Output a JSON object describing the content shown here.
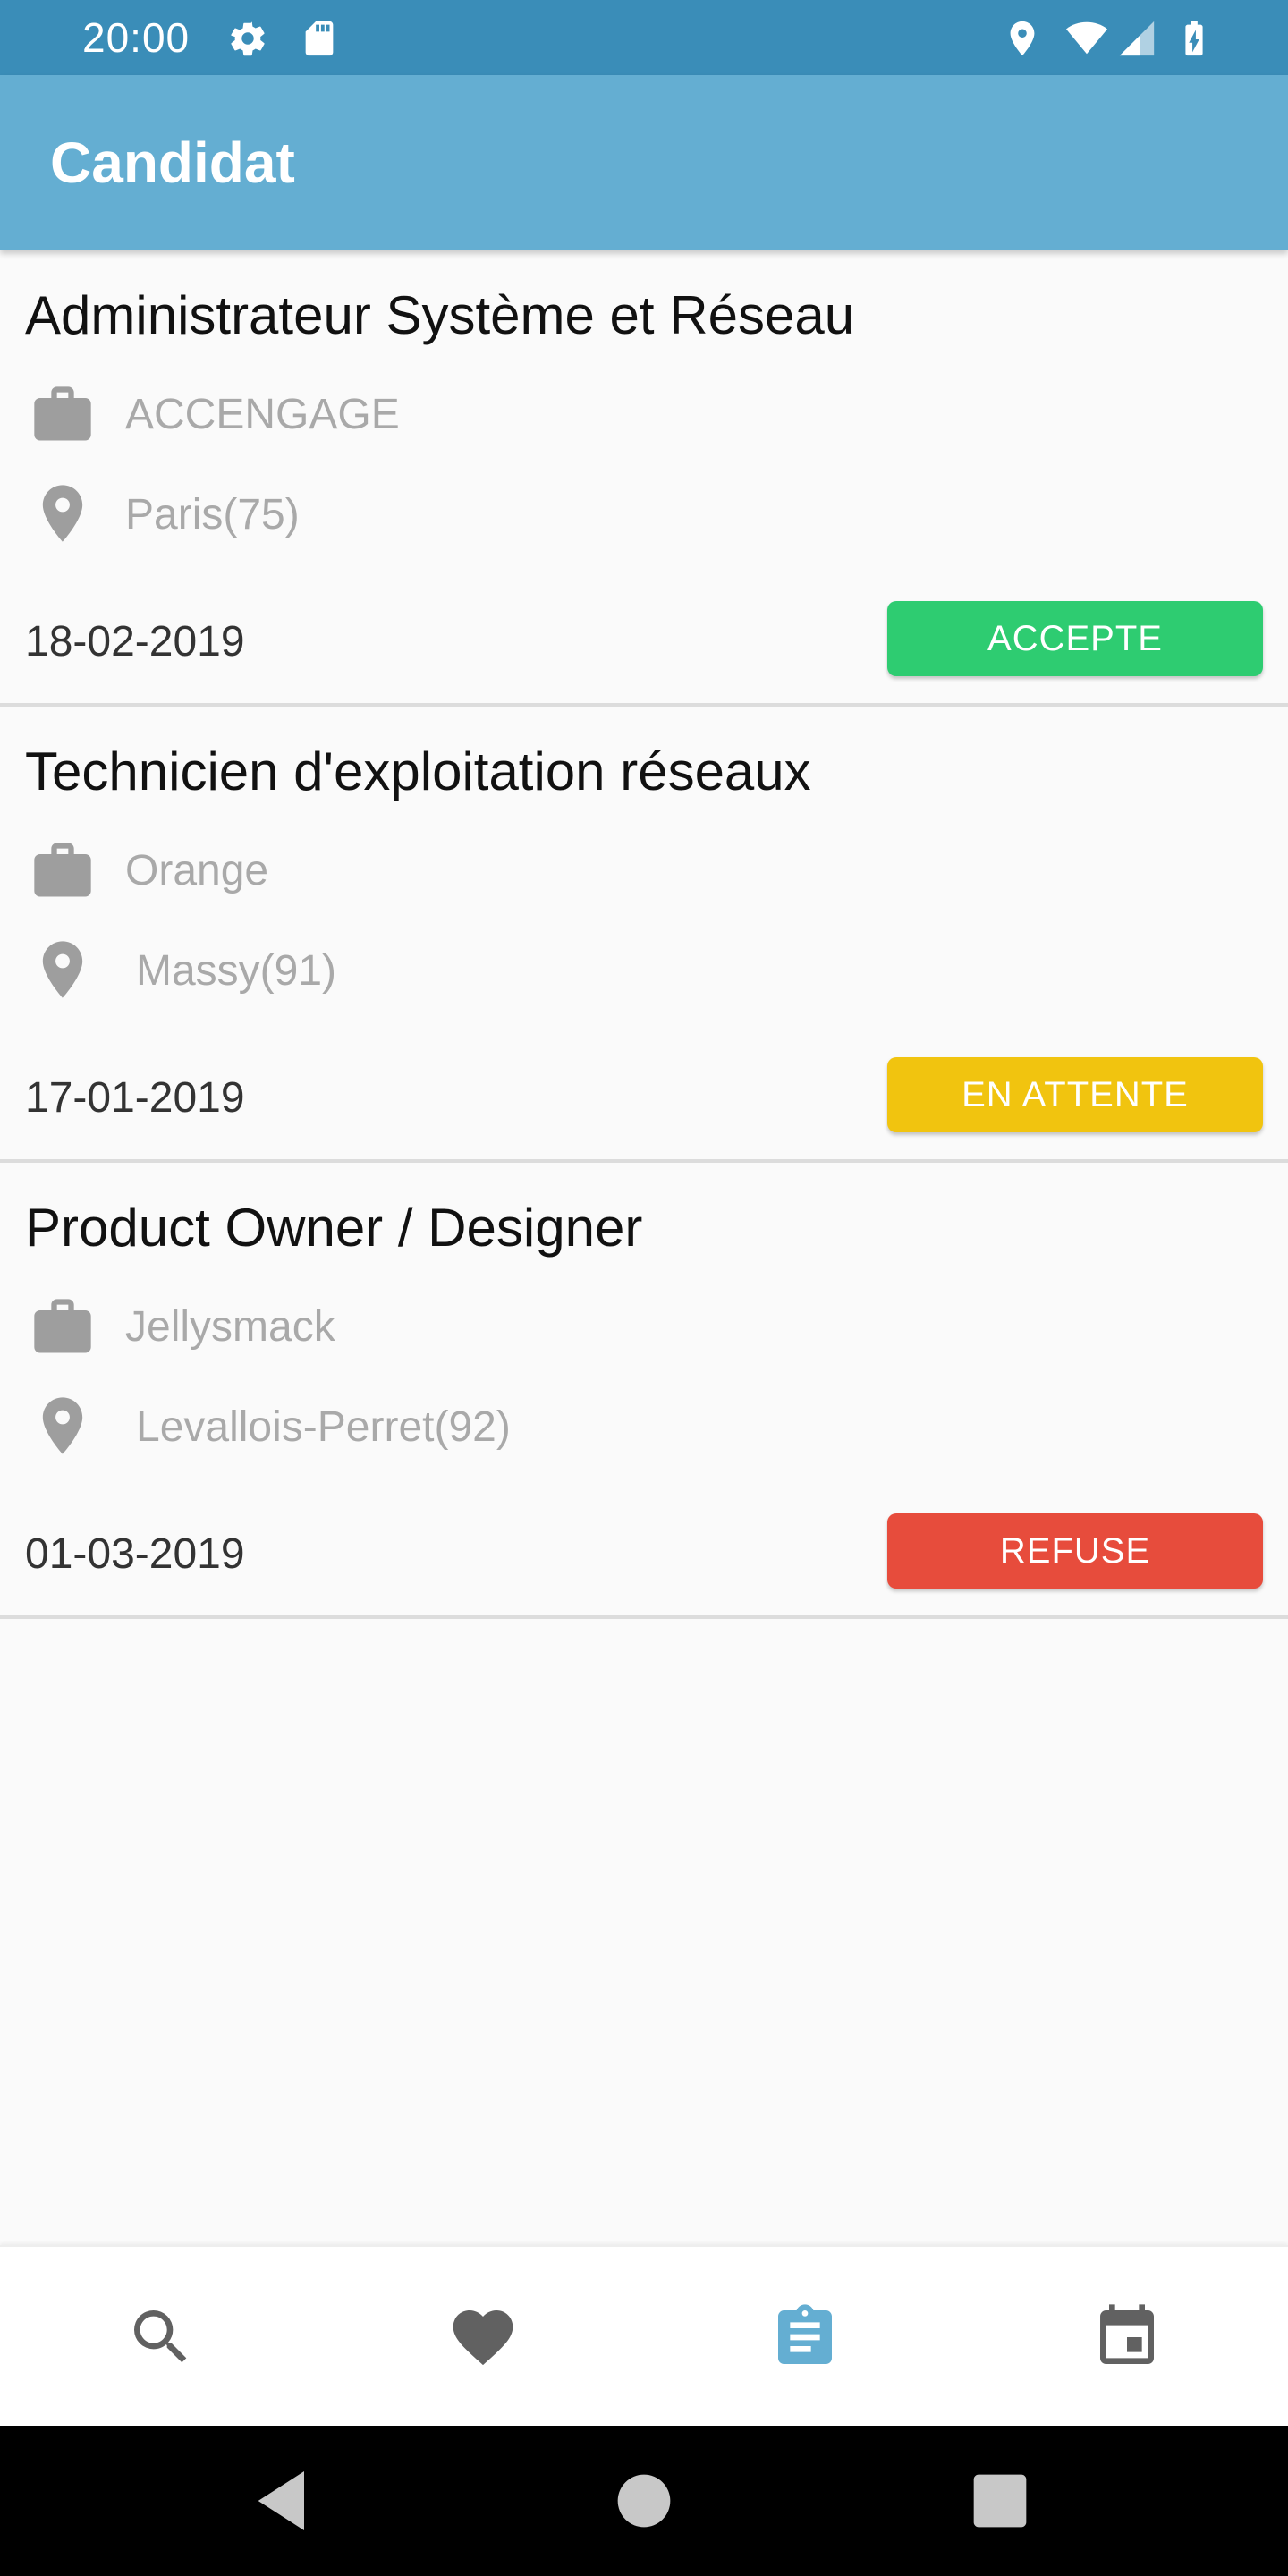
{
  "status_bar": {
    "time": "20:00",
    "icons": [
      "gear-icon",
      "sd-card-icon",
      "location-icon",
      "wifi-icon",
      "signal-icon",
      "battery-charging-icon"
    ]
  },
  "app_bar": {
    "title": "Candidat"
  },
  "applications": [
    {
      "title": "Administrateur Système et Réseau",
      "company": "ACCENGAGE",
      "location": "Paris(75)",
      "date": "18-02-2019",
      "status": "ACCEPTE",
      "status_color": "#2ecc71"
    },
    {
      "title": "Technicien d'exploitation réseaux",
      "company": "Orange",
      "location": "Massy(91)",
      "date": "17-01-2019",
      "status": "EN ATTENTE",
      "status_color": "#f1c40f"
    },
    {
      "title": "Product Owner / Designer",
      "company": "Jellysmack",
      "location": "Levallois-Perret(92)",
      "date": "01-03-2019",
      "status": "REFUSE",
      "status_color": "#e74c3c"
    }
  ],
  "bottom_nav": {
    "items": [
      {
        "icon": "search-icon",
        "active": false
      },
      {
        "icon": "heart-icon",
        "active": false
      },
      {
        "icon": "clipboard-icon",
        "active": true
      },
      {
        "icon": "calendar-icon",
        "active": false
      }
    ],
    "active_color": "#64aed2",
    "inactive_color": "#616161"
  },
  "system_nav": {
    "items": [
      "back-icon",
      "home-icon",
      "recents-icon"
    ]
  },
  "colors": {
    "status_bar": "#3a8db8",
    "app_bar": "#64aed2",
    "background": "#fafafa"
  }
}
